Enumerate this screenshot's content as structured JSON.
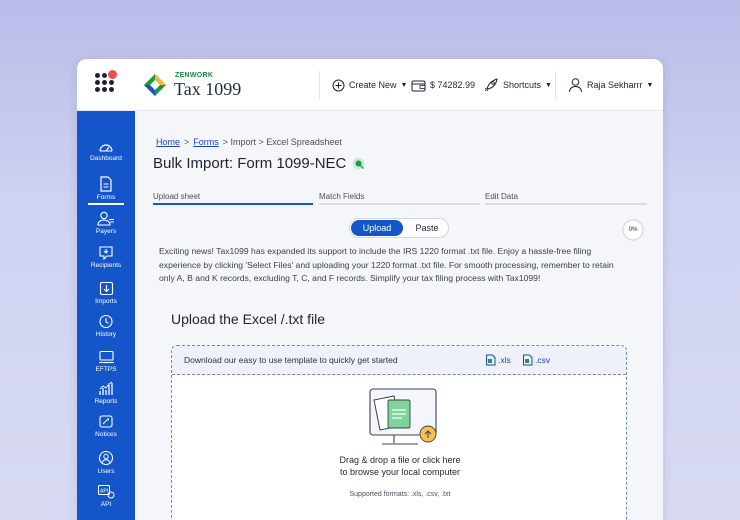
{
  "app": {
    "brand_small": "ZENWORK",
    "brand_main": "Tax 1099"
  },
  "topnav": {
    "create_new": "Create New",
    "balance": "$ 74282.99",
    "shortcuts": "Shortcuts",
    "user": "Raja Sekharrr"
  },
  "sidebar": {
    "items": [
      {
        "label": "Dashboard",
        "icon": "dashboard-icon"
      },
      {
        "label": "Forms",
        "icon": "forms-icon",
        "active": true
      },
      {
        "label": "Payers",
        "icon": "payers-icon"
      },
      {
        "label": "Recipients",
        "icon": "recipients-icon"
      },
      {
        "label": "Imports",
        "icon": "imports-icon"
      },
      {
        "label": "History",
        "icon": "history-icon"
      },
      {
        "label": "EFTPS",
        "icon": "eftps-icon"
      },
      {
        "label": "Reports",
        "icon": "reports-icon"
      },
      {
        "label": "Notices",
        "icon": "notices-icon"
      },
      {
        "label": "Users",
        "icon": "users-icon"
      },
      {
        "label": "API",
        "icon": "api-icon"
      }
    ]
  },
  "breadcrumb": {
    "home": "Home",
    "sep1": ">",
    "forms": "Forms",
    "rest": "> Import > Excel Spreadsheet"
  },
  "page": {
    "title": "Bulk Import: Form 1099-NEC"
  },
  "steps": [
    {
      "label": "Upload sheet",
      "active": true
    },
    {
      "label": "Match Fields",
      "active": false
    },
    {
      "label": "Edit Data",
      "active": false
    }
  ],
  "mode_toggle": {
    "active": "Upload",
    "other": "Paste"
  },
  "progress": {
    "label": "0%",
    "value": 0
  },
  "notice": "Exciting news! Tax1099 has expanded its support to include the IRS 1220 format .txt file. Enjoy a hassle-free filing experience by clicking 'Select Files' and uploading your 1220 format .txt file. For smooth processing, remember to retain only A, B and K records, excluding T, C, and F records. Simplify your tax filing process with Tax1099!",
  "upload": {
    "title": "Upload the Excel /.txt file",
    "template_text": "Download our easy to use template to quickly get started",
    "template_xls": ".xls",
    "template_csv": ".csv",
    "drop_line1": "Drag & drop a file or click here",
    "drop_line2": "to browse your local computer",
    "formats": "Supported formats: .xls, .csv, .txt"
  },
  "colors": {
    "primary": "#1456c9",
    "brand_green": "#1a8a3c",
    "alert_red": "#ef4d4d",
    "link": "#1748b8"
  }
}
